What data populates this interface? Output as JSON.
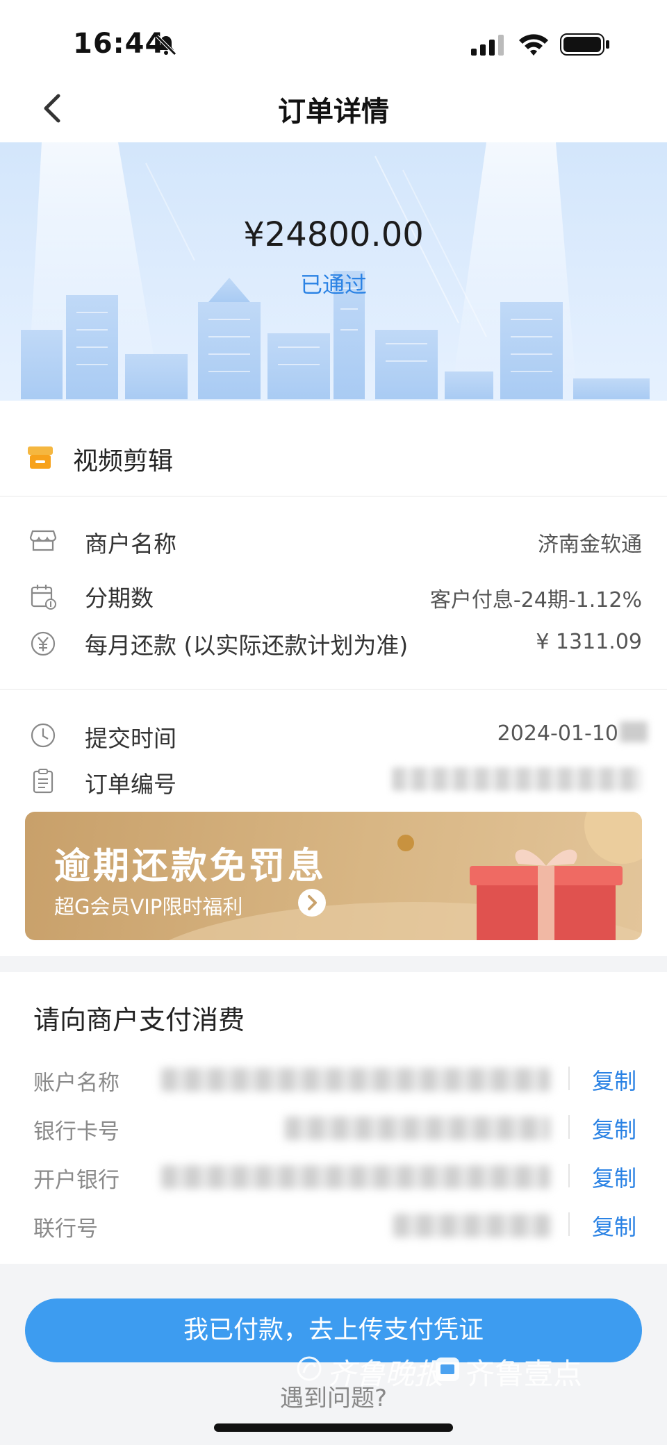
{
  "status_bar": {
    "time": "16:44"
  },
  "nav": {
    "title": "订单详情"
  },
  "hero": {
    "amount": "¥24800.00",
    "status": "已通过"
  },
  "product": {
    "name": "视频剪辑"
  },
  "details": [
    {
      "label": "商户名称",
      "value": "济南金软通"
    },
    {
      "label": "分期数",
      "value": "客户付息-24期-1.12%"
    },
    {
      "label": "每月还款 (以实际还款计划为准)",
      "value": "¥ 1311.09"
    }
  ],
  "order": [
    {
      "label": "提交时间",
      "value": "2024-01-10"
    },
    {
      "label": "订单编号",
      "value": ""
    }
  ],
  "banner": {
    "title": "逾期还款免罚息",
    "subtitle": "超G会员VIP限时福利"
  },
  "payment": {
    "title": "请向商户支付消费",
    "copy_label": "复制",
    "rows": [
      {
        "label": "账户名称"
      },
      {
        "label": "银行卡号"
      },
      {
        "label": "开户银行"
      },
      {
        "label": "联行号"
      }
    ]
  },
  "actions": {
    "paid_button": "我已付款，去上传支付凭证",
    "help": "遇到问题?"
  },
  "watermark": {
    "text1": "齐鲁晚报",
    "text2": "齐鲁壹点"
  },
  "colors": {
    "accent": "#2a82e4",
    "button": "#3d9cf0",
    "banner": "#d0aa74"
  }
}
